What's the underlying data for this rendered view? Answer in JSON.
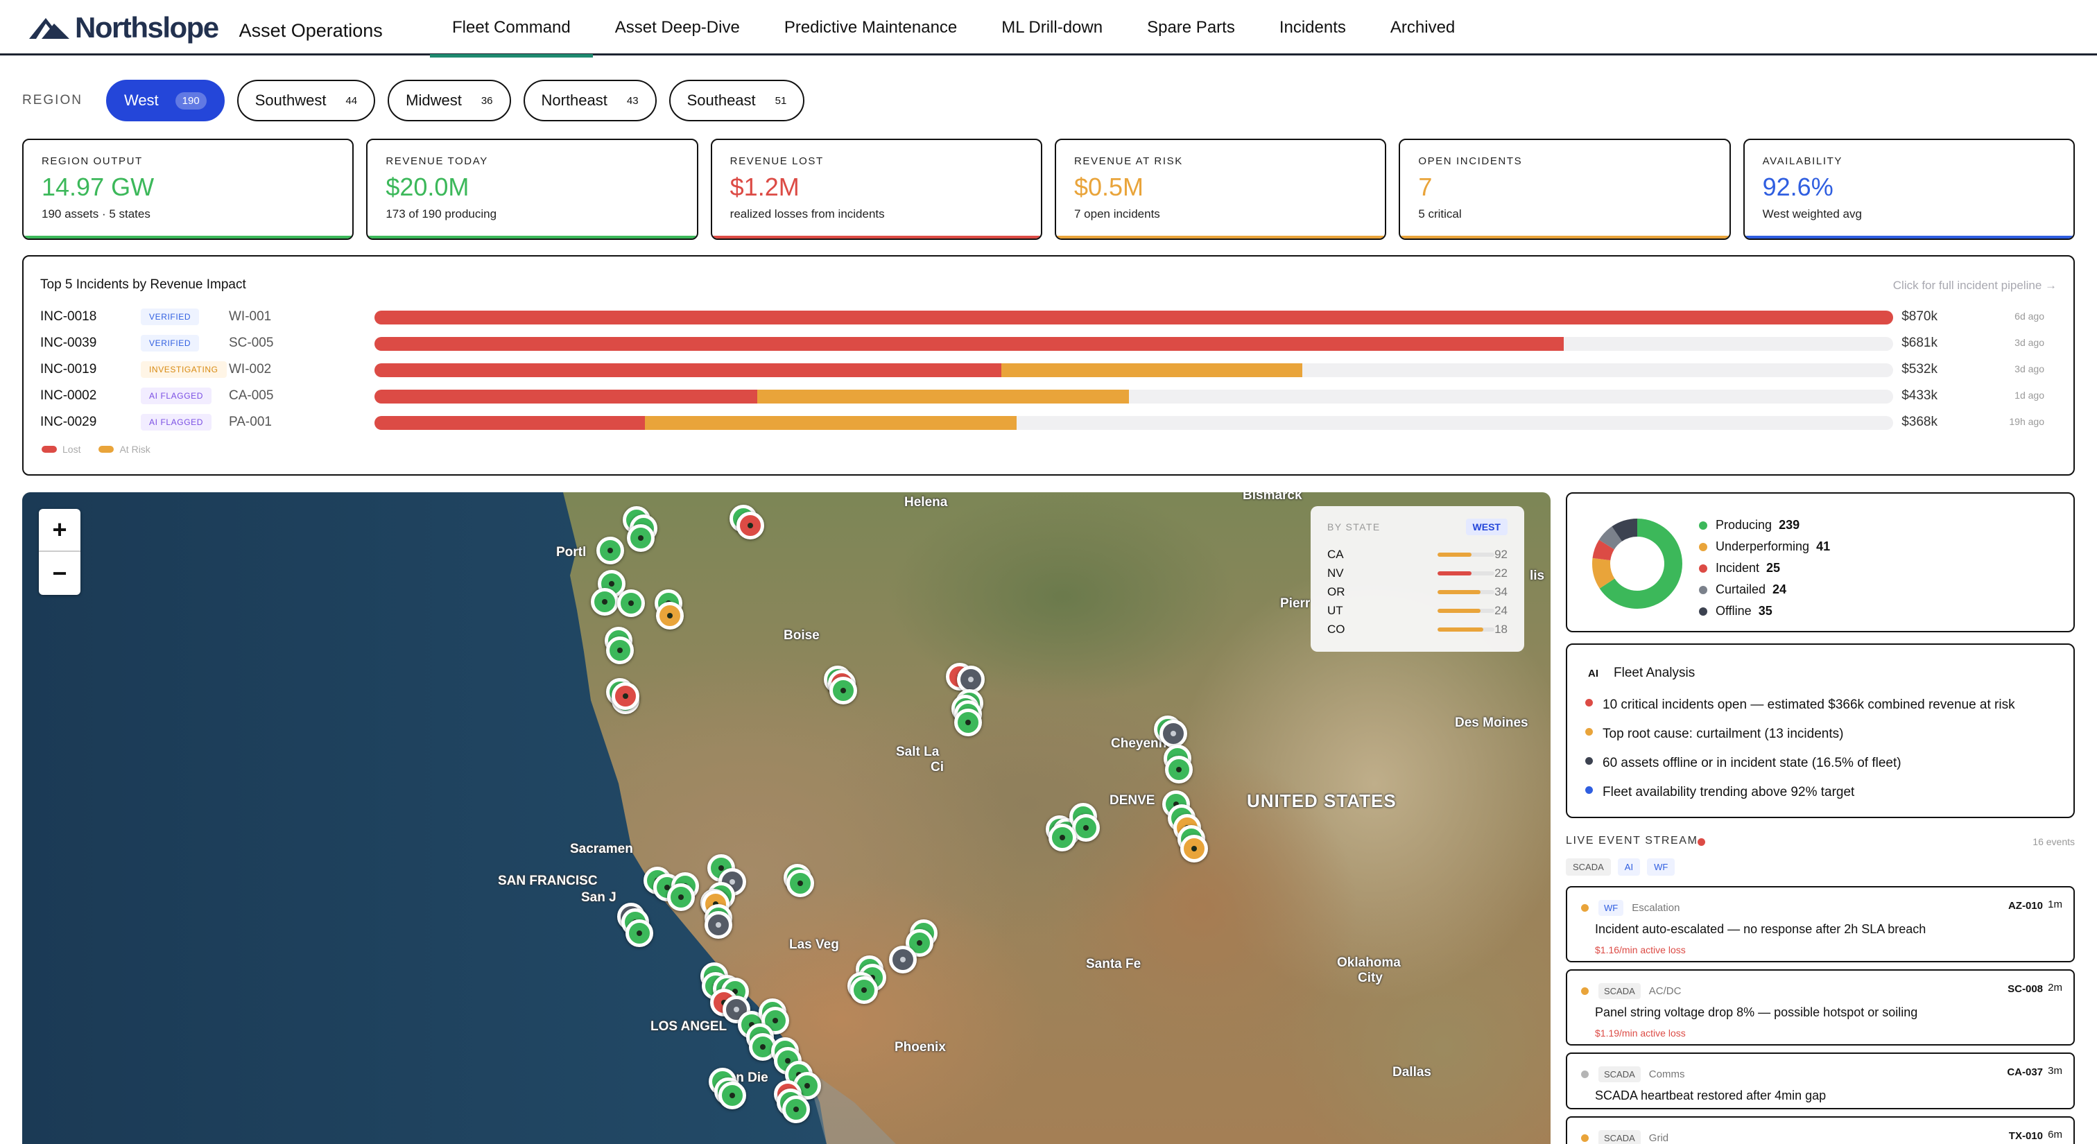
{
  "header": {
    "brand": "Northslope",
    "product": "Asset Operations",
    "tabs": [
      {
        "label": "Fleet Command"
      },
      {
        "label": "Asset Deep-Dive"
      },
      {
        "label": "Predictive Maintenance"
      },
      {
        "label": "ML Drill-down"
      },
      {
        "label": "Spare Parts"
      },
      {
        "label": "Incidents"
      },
      {
        "label": "Archived"
      }
    ],
    "active_tab": "Fleet Command"
  },
  "region": {
    "label": "REGION",
    "chips": [
      {
        "name": "West",
        "count": "190"
      },
      {
        "name": "Southwest",
        "count": "44"
      },
      {
        "name": "Midwest",
        "count": "36"
      },
      {
        "name": "Northeast",
        "count": "43"
      },
      {
        "name": "Southeast",
        "count": "51"
      }
    ],
    "selected": "West"
  },
  "kpis": [
    {
      "label": "REGION OUTPUT",
      "value": "14.97 GW",
      "sub": "190 assets · 5 states",
      "color": "#3cb85a"
    },
    {
      "label": "REVENUE TODAY",
      "value": "$20.0M",
      "sub": "173 of 190 producing",
      "color": "#3cb85a"
    },
    {
      "label": "REVENUE LOST",
      "value": "$1.2M",
      "sub": "realized losses from incidents",
      "color": "#dc4b45"
    },
    {
      "label": "REVENUE AT RISK",
      "value": "$0.5M",
      "sub": "7 open incidents",
      "color": "#e9a43a"
    },
    {
      "label": "OPEN INCIDENTS",
      "value": "7",
      "sub": "5 critical",
      "color": "#e9a43a"
    },
    {
      "label": "AVAILABILITY",
      "value": "92.6%",
      "sub": "West weighted avg",
      "color": "#2f5ee0"
    }
  ],
  "incidents": {
    "title": "Top 5 Incidents by Revenue Impact",
    "link": "Click for full incident pipeline →",
    "rows": [
      {
        "id": "INC-0018",
        "status": "VERIFIED",
        "status_kind": "verified",
        "asset": "WI-001",
        "lost": 1.0,
        "risk": 0.0,
        "amount": "$870k",
        "age": "6d ago"
      },
      {
        "id": "INC-0039",
        "status": "VERIFIED",
        "status_kind": "verified",
        "asset": "SC-005",
        "lost": 0.783,
        "risk": 0.0,
        "amount": "$681k",
        "age": "3d ago"
      },
      {
        "id": "INC-0019",
        "status": "INVESTIGATING",
        "status_kind": "investigating",
        "asset": "WI-002",
        "lost": 0.413,
        "risk": 0.198,
        "amount": "$532k",
        "age": "3d ago"
      },
      {
        "id": "INC-0002",
        "status": "AI FLAGGED",
        "status_kind": "flagged",
        "asset": "CA-005",
        "lost": 0.252,
        "risk": 0.245,
        "amount": "$433k",
        "age": "1d ago"
      },
      {
        "id": "INC-0029",
        "status": "AI FLAGGED",
        "status_kind": "flagged",
        "asset": "PA-001",
        "lost": 0.178,
        "risk": 0.245,
        "amount": "$368k",
        "age": "19h ago"
      }
    ],
    "legend": [
      {
        "label": "Lost",
        "color": "#dc4b45"
      },
      {
        "label": "At Risk",
        "color": "#e9a43a"
      }
    ]
  },
  "map": {
    "zoom_in": "+",
    "zoom_out": "−",
    "labels": {
      "helena": "Helena",
      "bismarck": "Bismarck",
      "portland": "Portl",
      "boise": "Boise",
      "pierre": "Pierr",
      "salt_lake": "Salt La",
      "salt_lake2": "Ci",
      "cheyenne": "Cheyenne",
      "denver": "DENVE",
      "us": "UNITED STATES",
      "des_moines": "Des Moines",
      "sacramento": "Sacramen",
      "sf": "SAN FRANCISC",
      "san_jose": "San J",
      "las_vegas": "Las Veg",
      "santa_fe": "Santa Fe",
      "oklahoma": "Oklahoma",
      "oklahoma2": "City",
      "los_angeles": "LOS ANGEL",
      "phoenix": "Phoenix",
      "san_diego": "San Die",
      "dallas": "Dallas",
      "minneapolis": "lis"
    },
    "by_state": {
      "title": "BY STATE",
      "tag": "WEST",
      "rows": [
        {
          "code": "CA",
          "value": "92",
          "fraction": 0.6,
          "color": "#e9a43a"
        },
        {
          "code": "NV",
          "value": "22",
          "fraction": 0.6,
          "color": "#dc4b45"
        },
        {
          "code": "OR",
          "value": "34",
          "fraction": 0.75,
          "color": "#e9a43a"
        },
        {
          "code": "UT",
          "value": "24",
          "fraction": 0.75,
          "color": "#e9a43a"
        },
        {
          "code": "CO",
          "value": "18",
          "fraction": 0.8,
          "color": "#e9a43a"
        }
      ]
    }
  },
  "status_breakdown": {
    "items": [
      {
        "label": "Producing",
        "count": 239,
        "color": "#3cb85a"
      },
      {
        "label": "Underperforming",
        "count": 41,
        "color": "#e9a43a"
      },
      {
        "label": "Incident",
        "count": 25,
        "color": "#dc4b45"
      },
      {
        "label": "Curtailed",
        "count": 24,
        "color": "#7b818b"
      },
      {
        "label": "Offline",
        "count": 35,
        "color": "#3c4250"
      }
    ]
  },
  "fleet_analysis": {
    "badge": "AI",
    "title": "Fleet Analysis",
    "items": [
      {
        "text": "10 critical incidents open — estimated $366k combined revenue at risk",
        "color": "#dc4b45"
      },
      {
        "text": "Top root cause: curtailment (13 incidents)",
        "color": "#e9a43a"
      },
      {
        "text": "60 assets offline or in incident state (16.5% of fleet)",
        "color": "#3c4250"
      },
      {
        "text": "Fleet availability trending above 92% target",
        "color": "#2f5ee0"
      }
    ]
  },
  "stream": {
    "title": "LIVE EVENT STREAM",
    "count": "16 events",
    "filters": [
      "SCADA",
      "AI",
      "WF"
    ],
    "events": [
      {
        "dot": "#e9a43a",
        "source": "WF",
        "source_kind": "wf",
        "category": "Escalation",
        "asset": "AZ-010",
        "age": "1m",
        "message": "Incident auto-escalated — no response after 2h SLA breach",
        "cost": "$1.16/min active loss"
      },
      {
        "dot": "#e9a43a",
        "source": "SCADA",
        "source_kind": "scada",
        "category": "AC/DC",
        "asset": "SC-008",
        "age": "2m",
        "message": "Panel string voltage drop 8% — possible hotspot or soiling",
        "cost": "$1.19/min active loss"
      },
      {
        "dot": "#b5b5b5",
        "source": "SCADA",
        "source_kind": "scada",
        "category": "Comms",
        "asset": "CA-037",
        "age": "3m",
        "message": "SCADA heartbeat restored after 4min gap",
        "cost": ""
      },
      {
        "dot": "#e9a43a",
        "source": "SCADA",
        "source_kind": "scada",
        "category": "Grid",
        "asset": "TX-010",
        "age": "6m",
        "message": "",
        "cost": ""
      }
    ]
  }
}
